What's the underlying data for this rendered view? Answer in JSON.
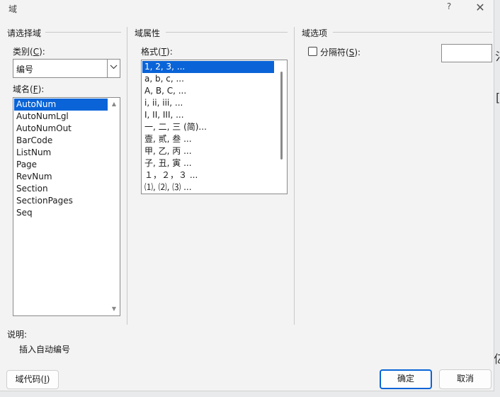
{
  "dialog": {
    "title": "域",
    "help_label": "?",
    "close_label": "✕"
  },
  "choose_field": {
    "group_title": "请选择域",
    "category_label_pre": "类别(",
    "category_label_key": "C",
    "category_label_post": "):",
    "category_value": "编号",
    "field_names_label_pre": "域名(",
    "field_names_label_key": "F",
    "field_names_label_post": "):",
    "field_names": [
      "AutoNum",
      "AutoNumLgl",
      "AutoNumOut",
      "BarCode",
      "ListNum",
      "Page",
      "RevNum",
      "Section",
      "SectionPages",
      "Seq"
    ],
    "selected_field": "AutoNum"
  },
  "field_properties": {
    "group_title": "域属性",
    "format_label_pre": "格式(",
    "format_label_key": "T",
    "format_label_post": "):",
    "formats": [
      "1, 2, 3, ...",
      "a, b, c, ...",
      "A, B, C, ...",
      "i, ii, iii, ...",
      "I, II, III, ...",
      "一, 二, 三 (简)...",
      "壹, 贰, 叁 ...",
      "甲, 乙, 丙 ...",
      "子, 丑, 寅 ...",
      "１，２，３ ...",
      "⑴, ⑵, ⑶ ..."
    ],
    "selected_format": "1, 2, 3, ..."
  },
  "field_options": {
    "group_title": "域选项",
    "separator_label_pre": "分隔符(",
    "separator_label_key": "S",
    "separator_label_post": "):",
    "separator_checked": false,
    "separator_value": ""
  },
  "description": {
    "label": "说明:",
    "text": "插入自动编号"
  },
  "buttons": {
    "field_codes_pre": "域代码(",
    "field_codes_key": "I",
    "field_codes_post": ")",
    "ok": "确定",
    "cancel": "取消"
  },
  "colors": {
    "selection": "#0a64d8",
    "dialog_bg": "#f3f3f3"
  }
}
